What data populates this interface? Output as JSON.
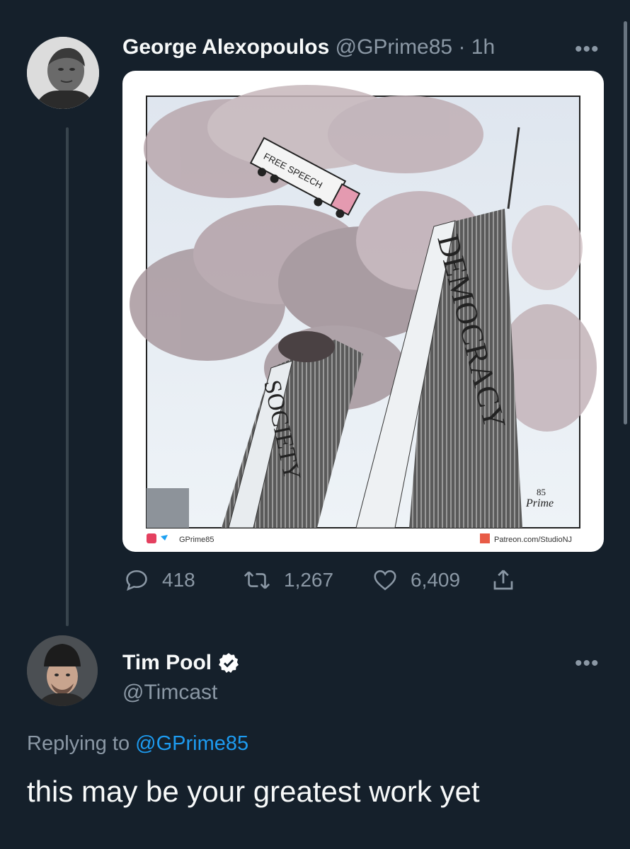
{
  "tweet": {
    "author_name": "George Alexopoulos",
    "author_handle": "@GPrime85",
    "time": "· 1h",
    "more": "•••",
    "image": {
      "truck_label": "FREE SPEECH",
      "tower_left_label": "SOCIETY",
      "tower_right_label": "DEMOCRACY",
      "footer_left": "GPrime85",
      "footer_right": "Patreon.com/StudioNJ",
      "signature_top": "85",
      "signature_bottom": "Prime"
    },
    "actions": {
      "replies": "418",
      "retweets": "1,267",
      "likes": "6,409"
    }
  },
  "reply": {
    "author_name": "Tim Pool",
    "author_handle": "@Timcast",
    "more": "•••",
    "replying_prefix": "Replying to",
    "replying_mention": "@GPrime85",
    "text": "this may be your greatest work yet"
  },
  "colors": {
    "background": "#15202b",
    "muted": "#8b98a5",
    "accent": "#1d9bf0",
    "thread_line": "#38444d"
  }
}
